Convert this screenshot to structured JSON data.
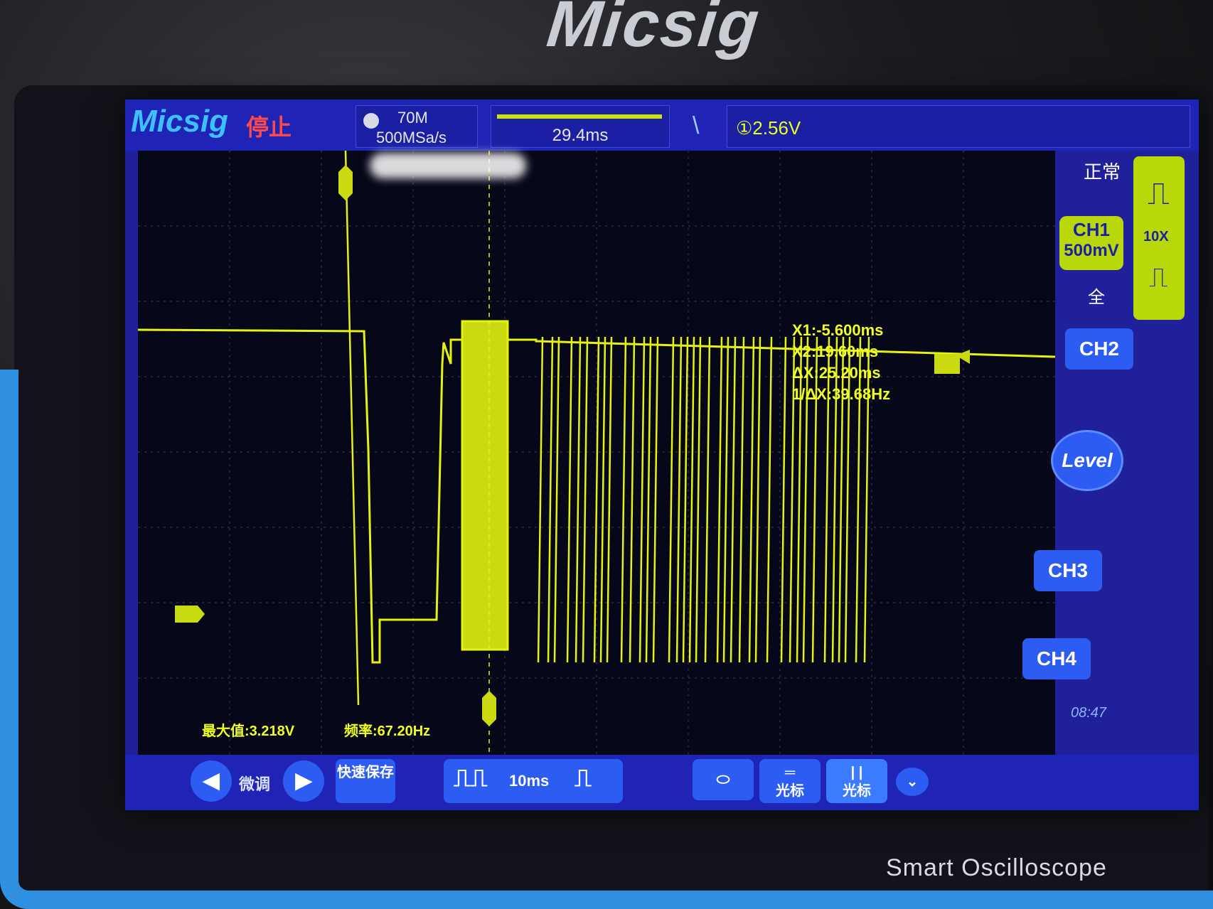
{
  "device": {
    "brand": "Micsig",
    "model_label": "Smart Oscilloscope"
  },
  "topbar": {
    "logo": "Micsig",
    "run_state": "停止",
    "bandwidth": "70M",
    "sample_rate": "500MSa/s",
    "time_position": "29.4ms",
    "trigger_level": "①2.56V",
    "trigger_mode": "正常"
  },
  "measurements": {
    "x1": "X1:-5.600ms",
    "x2": "X2:19.60ms",
    "dx": "ΔX:25.20ms",
    "inv_dx": "1/ΔX:39.68Hz",
    "max": "最大值:3.218V",
    "freq": "频率:67.20Hz"
  },
  "channel1": {
    "name": "CH1",
    "scale": "500mV",
    "coupling": "全",
    "probe": "10X"
  },
  "right_panel": {
    "ch2": "CH2",
    "ch3": "CH3",
    "ch4": "CH4",
    "level": "Level",
    "clock": "08:47"
  },
  "bottom_bar": {
    "fine_adjust": "微调",
    "quick_save": "快速保存",
    "timebase": "10ms",
    "cursor_label": "光标"
  },
  "colors": {
    "trace": "#e3f20e",
    "screen_bg": "#07071a",
    "ui_blue": "#2d5cf2"
  }
}
